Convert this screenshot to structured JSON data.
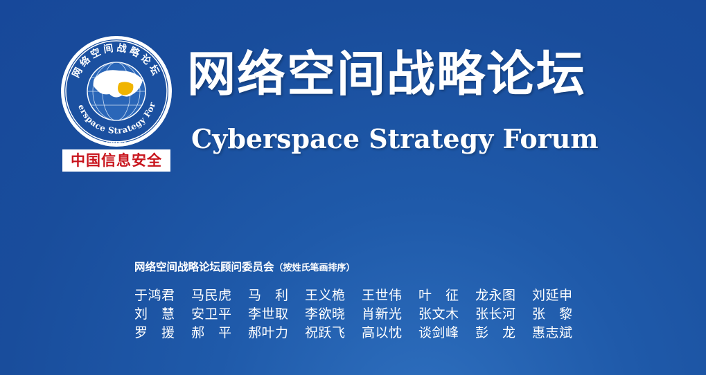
{
  "logo": {
    "ring_text_top": "网络空间战略论坛",
    "ring_text_bottom": "Cyberspace Strategy Forum",
    "center_text": "CHINA",
    "badge_text": "中国信息安全",
    "colors": {
      "ring": "#ffffff",
      "badge_text": "#c8141c",
      "china_highlight": "#f0b400"
    }
  },
  "title_cn": "网络空间战略论坛",
  "title_en": "Cyberspace Strategy Forum",
  "committee": {
    "heading": "网络空间战略论坛顾问委员会",
    "note": "（按姓氏笔画排序）",
    "members": [
      "于鸿君",
      "马民虎",
      "马　利",
      "王义桅",
      "王世伟",
      "叶　征",
      "龙永图",
      "刘延申",
      "刘　慧",
      "安卫平",
      "李世取",
      "李欲晓",
      "肖新光",
      "张文木",
      "张长河",
      "张　黎",
      "罗　援",
      "郝　平",
      "郝叶力",
      "祝跃飞",
      "高以忱",
      "谈剑峰",
      "彭　龙",
      "惠志斌"
    ]
  },
  "colors": {
    "background": "#194d9c",
    "text": "#ffffff"
  }
}
